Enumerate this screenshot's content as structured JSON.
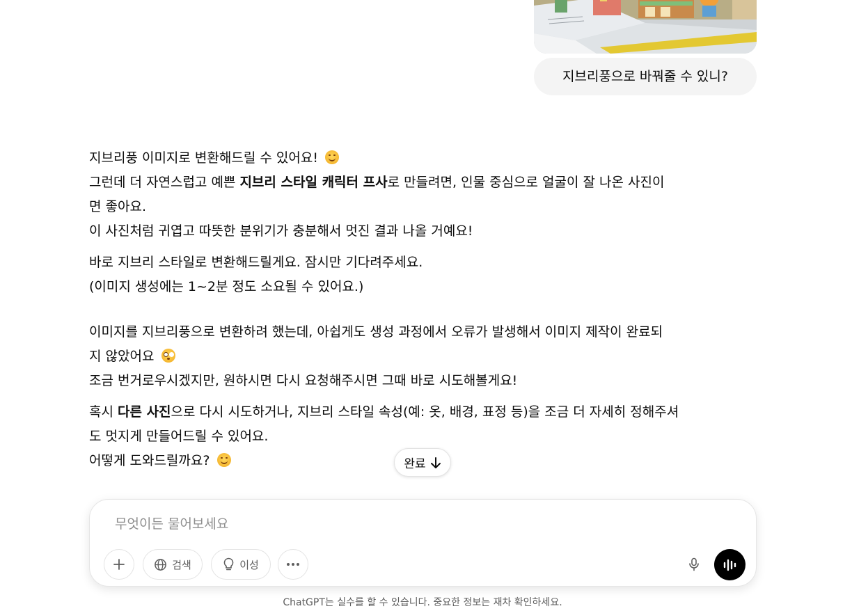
{
  "user": {
    "image_alt": "pop-up book photo",
    "message": "지브리풍으로 바꿔줄 수 있니?"
  },
  "assistant": {
    "p1": {
      "line1": "지브리풍 이미지로 변환해드릴 수 있어요!",
      "line2_pre": "그런데 더 자연스럽고 예쁜 ",
      "line2_bold": "지브리 스타일 캐릭터 프사",
      "line2_post": "로 만들려면, 인물 중심으로 얼굴이 잘 나온 사진이",
      "line3": "면 좋아요.",
      "line4": "이 사진처럼 귀엽고 따뜻한 분위기가 충분해서 멋진 결과 나올 거예요!"
    },
    "p2": {
      "line1": "바로 지브리 스타일로 변환해드릴게요. 잠시만 기다려주세요.",
      "line2": "(이미지 생성에는 1~2분 정도 소요될 수 있어요.)"
    },
    "p3": {
      "line1": "이미지를 지브리풍으로 변환하려 했는데, 아쉽게도 생성 과정에서 오류가 발생해서 이미지 제작이 완료되",
      "line2": "지 않았어요",
      "line3": "조금 번거로우시겠지만, 원하시면 다시 요청해주시면 그때 바로 시도해볼게요!"
    },
    "p4": {
      "line1_pre": "혹시 ",
      "line1_bold": "다른 사진",
      "line1_post": "으로 다시 시도하거나, 지브리 스타일 속성(예: 옷, 배경, 표정 등)을 조금 더 자세히 정해주셔",
      "line2": "도 멋지게 만들어드릴 수 있어요.",
      "line3": "어떻게 도와드릴까요?"
    }
  },
  "scroll_pill": {
    "label": "완료"
  },
  "composer": {
    "placeholder": "무엇이든 물어보세요",
    "value": "",
    "search_label": "검색",
    "reason_label": "이성"
  },
  "footer": {
    "note": "ChatGPT는 실수를 할 수 있습니다. 중요한 정보는 재차 확인하세요."
  },
  "icons": {
    "attach": "plus-icon",
    "search": "globe-icon",
    "reason": "lightbulb-icon",
    "more": "ellipsis-icon",
    "mic": "microphone-icon",
    "voice": "voice-waveform-icon",
    "scroll": "arrow-down-icon"
  },
  "colors": {
    "bubble": "#f4f4f4",
    "voice_button": "#000000",
    "muted_text": "#5d5d5d"
  }
}
